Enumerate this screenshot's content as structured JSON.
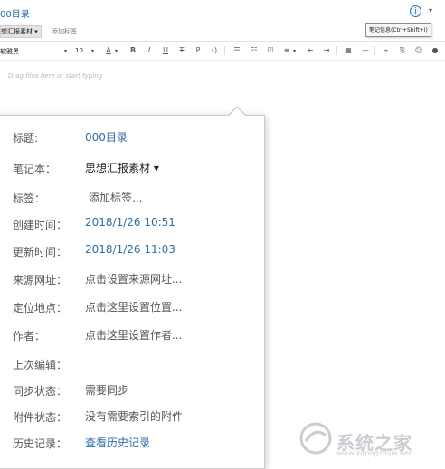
{
  "header": {
    "note_title": "00目录",
    "info_icon_glyph": "i",
    "more_glyph": "▾",
    "tooltip": "笔记信息(Ctrl+Shift+I)",
    "notebook_selector": "想汇报素材 ▾",
    "add_tag": "添加标签..."
  },
  "toolbar": {
    "font_name": "软雅黑",
    "font_size": "10",
    "dropdown_glyph": "▾",
    "text_color_glyph": "A",
    "bold": "B",
    "italic": "I",
    "underline": "U",
    "strike": "T",
    "highlight": "P",
    "code": "()",
    "list_bullet": "☰",
    "list_number": "☷",
    "checkbox": "☑",
    "align": "≡",
    "indent_out": "⇤",
    "indent_in": "⇥",
    "table": "▦",
    "hr": "—",
    "link": "⌁",
    "attach": "⎘",
    "emoji": "☺",
    "more": "●"
  },
  "editor": {
    "placeholder": "Drag files here or start typing"
  },
  "info_panel": {
    "rows": [
      {
        "label": "标题:",
        "value": "000目录"
      },
      {
        "label": "笔记本：",
        "value": "思想汇报素材 ▾"
      },
      {
        "label": "标签：",
        "value": "添加标签..."
      },
      {
        "label": "创建时间：",
        "value": "2018/1/26 10:51"
      },
      {
        "label": "更新时间：",
        "value": "2018/1/26 11:03"
      },
      {
        "label": "来源网址：",
        "value": "点击设置来源网址..."
      },
      {
        "label": "定位地点：",
        "value": "点击这里设置位置..."
      },
      {
        "label": "作者：",
        "value": "点击这里设置作者..."
      },
      {
        "label": "上次编辑：",
        "value": ""
      },
      {
        "label": "同步状态：",
        "value": "需要同步"
      },
      {
        "label": "附件状态：",
        "value": "没有需要索引的附件"
      },
      {
        "label": "历史记录：",
        "value": "查看历史记录"
      }
    ]
  },
  "watermark": {
    "text": "系统之家",
    "url": "www.xitongzhijia.net"
  },
  "colors": {
    "link": "#2e6da4",
    "label": "#555555"
  }
}
